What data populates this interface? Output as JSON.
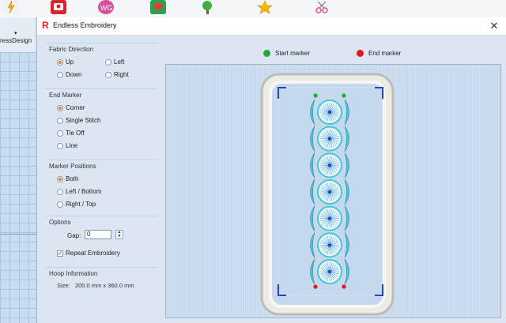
{
  "background_app": {
    "left_label": "ressDesign",
    "toolbar_icons": [
      "lightning-icon",
      "machine-icon",
      "heart-logo-icon",
      "rose-icon",
      "tree-icon",
      "star-icon",
      "scissors-icon"
    ]
  },
  "dialog": {
    "title": "Endless Embroidery",
    "close_glyph": "✕",
    "fabric_direction": {
      "title": "Fabric Direction",
      "options": [
        "Up",
        "Left",
        "Down",
        "Right"
      ],
      "selected": "Up"
    },
    "end_marker": {
      "title": "End Marker",
      "options": [
        "Corner",
        "Single Stitch",
        "Tie Off",
        "Line"
      ],
      "selected": "Corner"
    },
    "marker_positions": {
      "title": "Marker Positions",
      "options": [
        "Both",
        "Left / Bottom",
        "Right / Top"
      ],
      "selected": "Both"
    },
    "options": {
      "title": "Options",
      "gap_label": "Gap:",
      "gap_value": "0",
      "repeat_label": "Repeat Embroidery",
      "repeat_checked": true
    },
    "hoop_information": {
      "title": "Hoop Information",
      "size_label": "Size:",
      "size_value": "200.0 mm x 360.0 mm"
    },
    "legend": {
      "start_label": "Start marker",
      "end_label": "End marker",
      "start_color": "#22aa33",
      "end_color": "#e01818"
    },
    "design": {
      "motif_count": 7,
      "motif_color": "#4cc3d6",
      "center_color": "#1e3fbf",
      "marker_line_color": "#0a1fb8"
    }
  }
}
